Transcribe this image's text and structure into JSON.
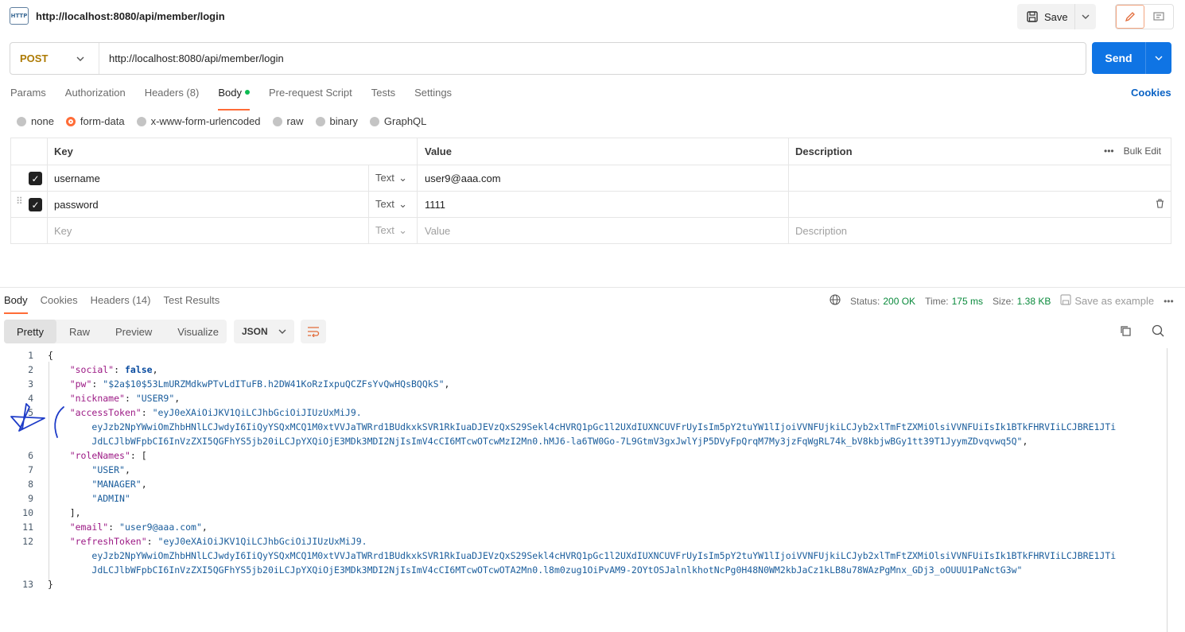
{
  "header": {
    "http_icon_label": "HTTP",
    "tab_title": "http://localhost:8080/api/member/login",
    "save_label": "Save"
  },
  "request": {
    "method": "POST",
    "url": "http://localhost:8080/api/member/login",
    "send_label": "Send"
  },
  "req_tabs": [
    {
      "label": "Params"
    },
    {
      "label": "Authorization"
    },
    {
      "label": "Headers (8)"
    },
    {
      "label": "Body"
    },
    {
      "label": "Pre-request Script"
    },
    {
      "label": "Tests"
    },
    {
      "label": "Settings"
    }
  ],
  "cookies_label": "Cookies",
  "body_types": [
    {
      "label": "none"
    },
    {
      "label": "form-data",
      "selected": true
    },
    {
      "label": "x-www-form-urlencoded"
    },
    {
      "label": "raw"
    },
    {
      "label": "binary"
    },
    {
      "label": "GraphQL"
    }
  ],
  "params_table": {
    "headers": {
      "key": "Key",
      "value": "Value",
      "description": "Description",
      "bulk_edit": "Bulk Edit"
    },
    "rows": [
      {
        "key": "username",
        "type": "Text",
        "value": "user9@aaa.com",
        "description": ""
      },
      {
        "key": "password",
        "type": "Text",
        "value": "1111",
        "description": ""
      }
    ],
    "placeholder": {
      "key": "Key",
      "type": "Text",
      "value": "Value",
      "description": "Description"
    }
  },
  "response": {
    "tabs": [
      {
        "label": "Body"
      },
      {
        "label": "Cookies"
      },
      {
        "label": "Headers (14)"
      },
      {
        "label": "Test Results"
      }
    ],
    "status_label": "Status:",
    "status_value": "200 OK",
    "time_label": "Time:",
    "time_value": "175 ms",
    "size_label": "Size:",
    "size_value": "1.38 KB",
    "save_example": "Save as example",
    "formats": [
      {
        "label": "Pretty"
      },
      {
        "label": "Raw"
      },
      {
        "label": "Preview"
      },
      {
        "label": "Visualize"
      }
    ],
    "lang": "JSON"
  },
  "code": {
    "l1": "{",
    "social_key": "\"social\"",
    "social_val": "false",
    "pw_key": "\"pw\"",
    "pw_val": "\"$2a$10$53LmURZMdkwPTvLdITuFB.h2DW41KoRzIxpuQCZFsYvQwHQsBQQkS\"",
    "nickname_key": "\"nickname\"",
    "nickname_val": "\"USER9\"",
    "access_key": "\"accessToken\"",
    "access_1": "\"eyJ0eXAiOiJKV1QiLCJhbGciOiJIUzUxMiJ9.",
    "access_2": "eyJzb2NpYWwiOmZhbHNlLCJwdyI6IiQyYSQxMCQ1M0xtVVJaTWRrd1BUdkxkSVR1RkIuaDJEVzQxS29Sekl4cHVRQ1pGc1l2UXdIUXNCUVFrUyIsIm5pY2tuYW1lIjoiVVNFUjkiLCJyb2xlTmFtZXMiOlsiVVNFUiIsIk1BTkFHRVIiLCJBRE1JTi",
    "access_3": "JdLCJlbWFpbCI6InVzZXI5QGFhYS5jb20iLCJpYXQiOjE3MDk3MDI2NjIsImV4cCI6MTcwOTcwMzI2Mn0.hMJ6-la6TW0Go-7L9GtmV3gxJwlYjP5DVyFpQrqM7My3jzFqWgRL74k_bV8kbjwBGy1tt39T1JyymZDvqvwq5Q\"",
    "roles_key": "\"roleNames\"",
    "role_1": "\"USER\"",
    "role_2": "\"MANAGER\"",
    "role_3": "\"ADMIN\"",
    "email_key": "\"email\"",
    "email_val": "\"user9@aaa.com\"",
    "refresh_key": "\"refreshToken\"",
    "refresh_1": "\"eyJ0eXAiOiJKV1QiLCJhbGciOiJIUzUxMiJ9.",
    "refresh_2": "eyJzb2NpYWwiOmZhbHNlLCJwdyI6IiQyYSQxMCQ1M0xtVVJaTWRrd1BUdkxkSVR1RkIuaDJEVzQxS29Sekl4cHVRQ1pGc1l2UXdIUXNCUVFrUyIsIm5pY2tuYW1lIjoiVVNFUjkiLCJyb2xlTmFtZXMiOlsiVVNFUiIsIk1BTkFHRVIiLCJBRE1JTi",
    "refresh_3": "JdLCJlbWFpbCI6InVzZXI5QGFhYS5jb20iLCJpYXQiOjE3MDk3MDI2NjIsImV4cCI6MTcwOTcwOTA2Mn0.l8m0zug1OiPvAM9-2OYtOSJalnlkhotNcPg0H48N0WM2kbJaCz1kLB8u78WAzPgMnx_GDj3_oOUUU1PaNctG3w\"",
    "l13": "}"
  }
}
